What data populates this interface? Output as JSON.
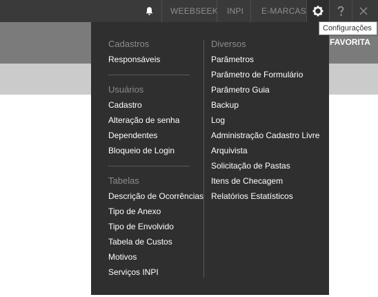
{
  "topbar": {
    "links": [
      "WEEBSEEK",
      "INPI",
      "E-MARCAS"
    ],
    "icons": [
      "bell-icon",
      "gear-icon",
      "question-icon",
      "close-icon"
    ]
  },
  "navbar": {
    "favorita_label": "FAVORITA"
  },
  "tooltip": {
    "text": "Configurações"
  },
  "menu": {
    "cadastros": {
      "title": "Cadastros",
      "items": [
        "Responsáveis"
      ]
    },
    "usuarios": {
      "title": "Usuários",
      "items": [
        "Cadastro",
        "Alteração de senha",
        "Dependentes",
        "Bloqueio de Login"
      ]
    },
    "tabelas": {
      "title": "Tabelas",
      "items": [
        "Descrição de Ocorrências",
        "Tipo de Anexo",
        "Tipo de Envolvido",
        "Tabela de Custos",
        "Motivos",
        "Serviços INPI"
      ]
    },
    "diversos": {
      "title": "Diversos",
      "items": [
        "Parâmetros",
        "Parâmetro de Formulário",
        "Parâmetro Guia",
        "Backup",
        "Log",
        "Administração Cadastro Livre",
        "Arquivista",
        "Solicitação de Pastas",
        "Itens de Checagem",
        "Relatórios Estatísticos"
      ]
    }
  },
  "colors": {
    "topbar_bg": "#3a3a3a",
    "menu_bg": "#2f2f2f",
    "navbar_bg": "#7b7b7b",
    "subbar_bg": "#cbcbcb"
  }
}
